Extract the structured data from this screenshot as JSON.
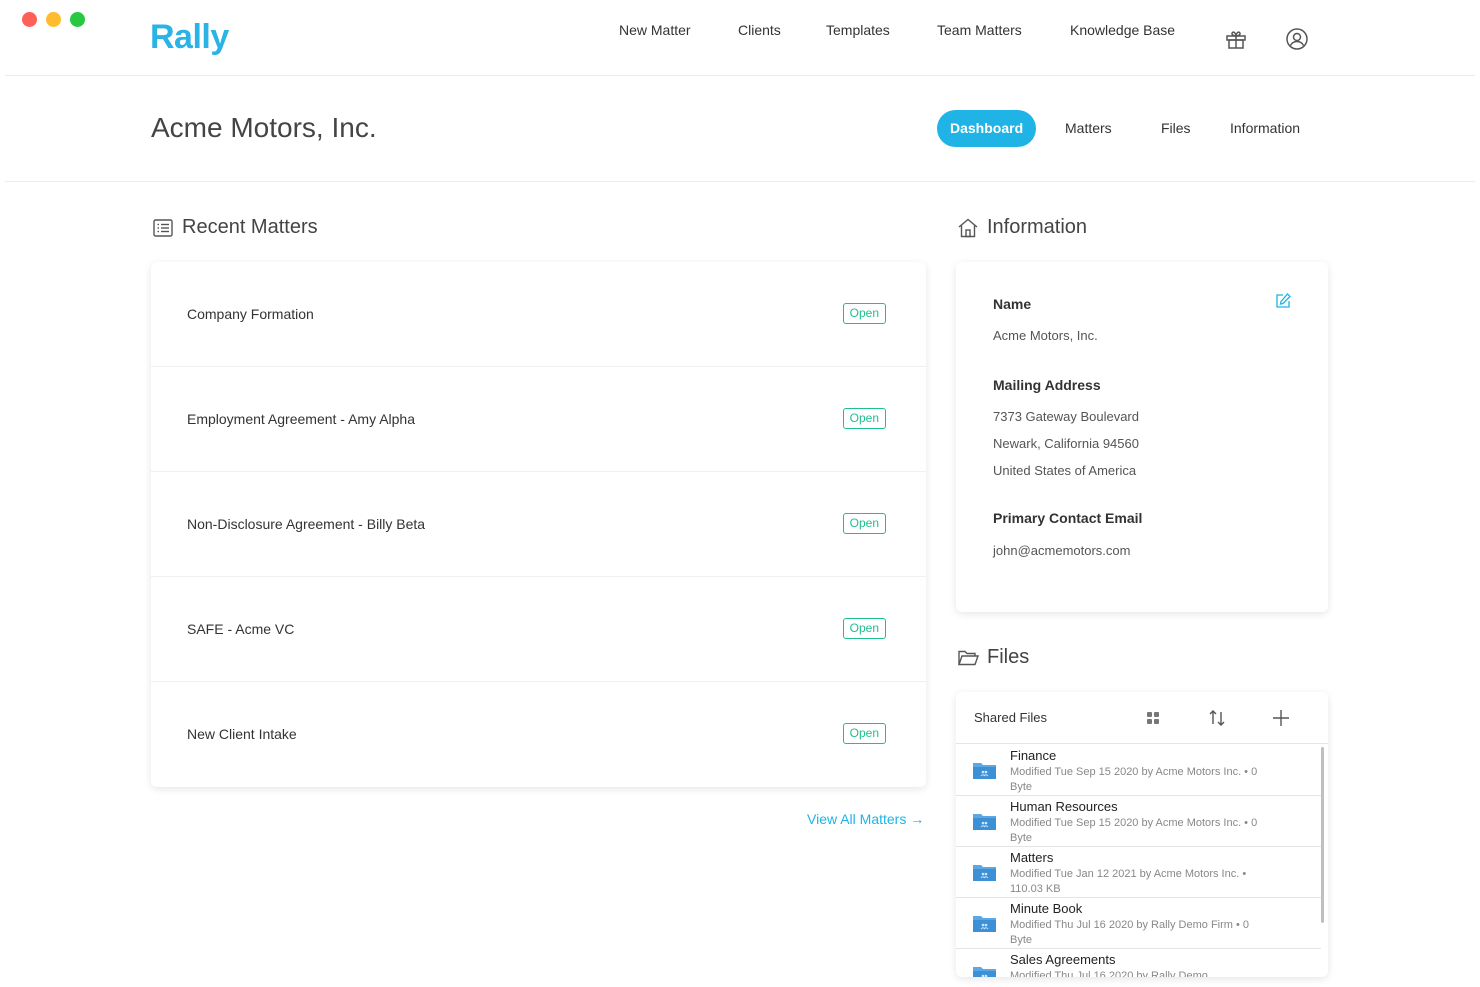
{
  "app": {
    "logo": "Rally"
  },
  "nav": {
    "items": [
      "New Matter",
      "Clients",
      "Templates",
      "Team Matters",
      "Knowledge Base"
    ],
    "icons": [
      "gift-icon",
      "user-account-icon"
    ]
  },
  "client": {
    "title": "Acme Motors, Inc.",
    "tabs": [
      {
        "label": "Dashboard",
        "active": true
      },
      {
        "label": "Matters",
        "active": false
      },
      {
        "label": "Files",
        "active": false
      },
      {
        "label": "Information",
        "active": false
      }
    ]
  },
  "recent_matters": {
    "title": "Recent Matters",
    "items": [
      {
        "name": "Company Formation",
        "status": "Open"
      },
      {
        "name": "Employment Agreement - Amy Alpha",
        "status": "Open"
      },
      {
        "name": "Non-Disclosure Agreement - Billy Beta",
        "status": "Open"
      },
      {
        "name": "SAFE - Acme VC",
        "status": "Open"
      },
      {
        "name": "New Client Intake",
        "status": "Open"
      }
    ],
    "view_all": "View All Matters →"
  },
  "information": {
    "title": "Information",
    "name_label": "Name",
    "name_value": "Acme Motors, Inc.",
    "address_label": "Mailing Address",
    "address_lines": [
      "7373 Gateway Boulevard",
      "Newark, California 94560",
      "United States of America"
    ],
    "email_label": "Primary Contact Email",
    "email_value": "john@acmemotors.com"
  },
  "files": {
    "title": "Files",
    "header_label": "Shared Files",
    "items": [
      {
        "name": "Finance",
        "meta": "Modified Tue Sep 15 2020 by Acme Motors Inc. • 0 Byte"
      },
      {
        "name": "Human Resources",
        "meta": "Modified Tue Sep 15 2020 by Acme Motors Inc. • 0 Byte"
      },
      {
        "name": "Matters",
        "meta": "Modified Tue Jan 12 2021 by Acme Motors Inc. • 110.03 KB"
      },
      {
        "name": "Minute Book",
        "meta": "Modified Thu Jul 16 2020 by Rally Demo Firm • 0 Byte"
      },
      {
        "name": "Sales Agreements",
        "meta": "Modified Thu Jul 16 2020 by Rally Demo"
      }
    ]
  },
  "colors": {
    "accent": "#1fb3e6",
    "open_badge": "#1fbf8f"
  }
}
